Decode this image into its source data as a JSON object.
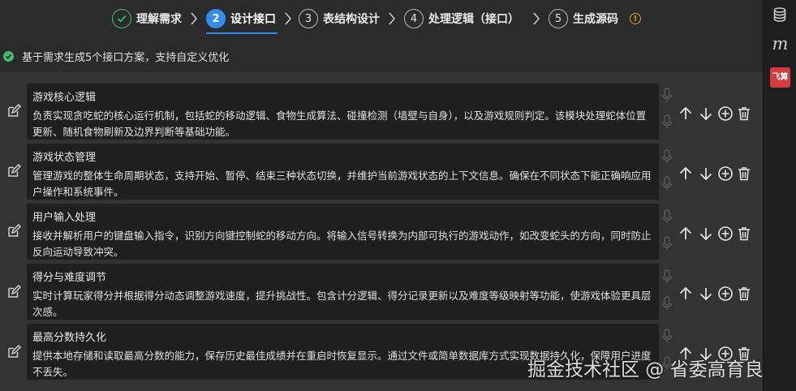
{
  "stepper": {
    "steps": [
      {
        "num": "✓",
        "label": "理解需求",
        "state": "done"
      },
      {
        "num": "2",
        "label": "设计接口",
        "state": "active"
      },
      {
        "num": "3",
        "label": "表结构设计",
        "state": "todo"
      },
      {
        "num": "4",
        "label": "处理逻辑（接口）",
        "state": "todo"
      },
      {
        "num": "5",
        "label": "生成源码",
        "state": "todo"
      }
    ],
    "info_icon": "!"
  },
  "status": {
    "text": "基于需求生成5个接口方案，支持自定义优化"
  },
  "sidebar": {
    "m_label": "m",
    "fei_label": "飞算"
  },
  "items": [
    {
      "title": "游戏核心逻辑",
      "desc": "负责实现贪吃蛇的核心运行机制，包括蛇的移动逻辑、食物生成算法、碰撞检测（墙壁与自身），以及游戏规则判定。该模块处理蛇体位置更新、随机食物刷新及边界判断等基础功能。"
    },
    {
      "title": "游戏状态管理",
      "desc": "管理游戏的整体生命周期状态，支持开始、暂停、结束三种状态切换，并维护当前游戏状态的上下文信息。确保在不同状态下能正确响应用户操作和系统事件。"
    },
    {
      "title": "用户输入处理",
      "desc": "接收并解析用户的键盘输入指令，识别方向键控制蛇的移动方向。将输入信号转换为内部可执行的游戏动作，如改变蛇头的方向，同时防止反向运动导致冲突。"
    },
    {
      "title": "得分与难度调节",
      "desc": "实时计算玩家得分并根据得分动态调整游戏速度，提升挑战性。包含计分逻辑、得分记录更新以及难度等级映射等功能，使游戏体验更具层次感。"
    },
    {
      "title": "最高分数持久化",
      "desc": "提供本地存储和读取最高分数的能力，保存历史最佳成绩并在重启时恢复显示。通过文件或简单数据库方式实现数据持久化，保障用户进度不丢失。"
    }
  ],
  "watermark": "掘金技术社区 @ 省委高育良"
}
